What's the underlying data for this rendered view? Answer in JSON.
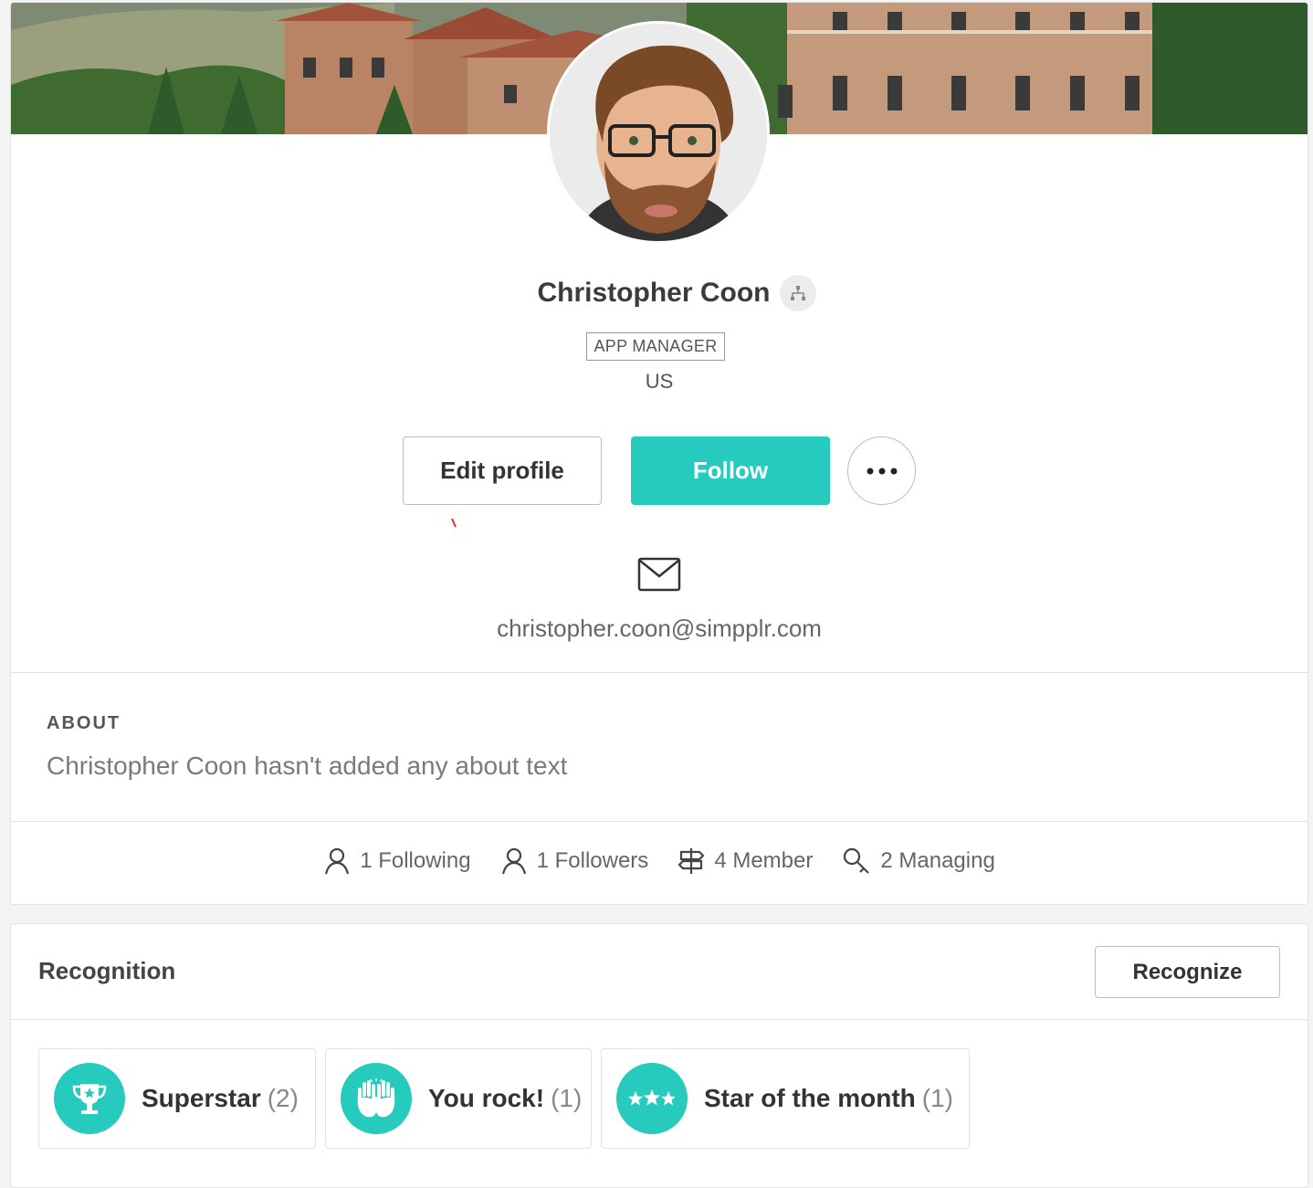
{
  "profile": {
    "name": "Christopher Coon",
    "role": "APP MANAGER",
    "location": "US",
    "email": "christopher.coon@simpplr.com",
    "edit_label": "Edit profile",
    "follow_label": "Follow",
    "accent_color": "#27cbbd"
  },
  "about": {
    "title": "ABOUT",
    "text": "Christopher Coon hasn't added any about text"
  },
  "stats": [
    {
      "icon": "person-icon",
      "label": "1 Following"
    },
    {
      "icon": "person-icon",
      "label": "1 Followers"
    },
    {
      "icon": "signpost-icon",
      "label": "4 Member"
    },
    {
      "icon": "key-icon",
      "label": "2 Managing"
    }
  ],
  "recognition": {
    "title": "Recognition",
    "recognize_label": "Recognize",
    "badges": [
      {
        "icon": "trophy-icon",
        "label": "Superstar",
        "count": "(2)"
      },
      {
        "icon": "high-five-icon",
        "label": "You rock!",
        "count": "(1)"
      },
      {
        "icon": "three-stars-icon",
        "label": "Star of the month",
        "count": "(1)"
      }
    ]
  }
}
